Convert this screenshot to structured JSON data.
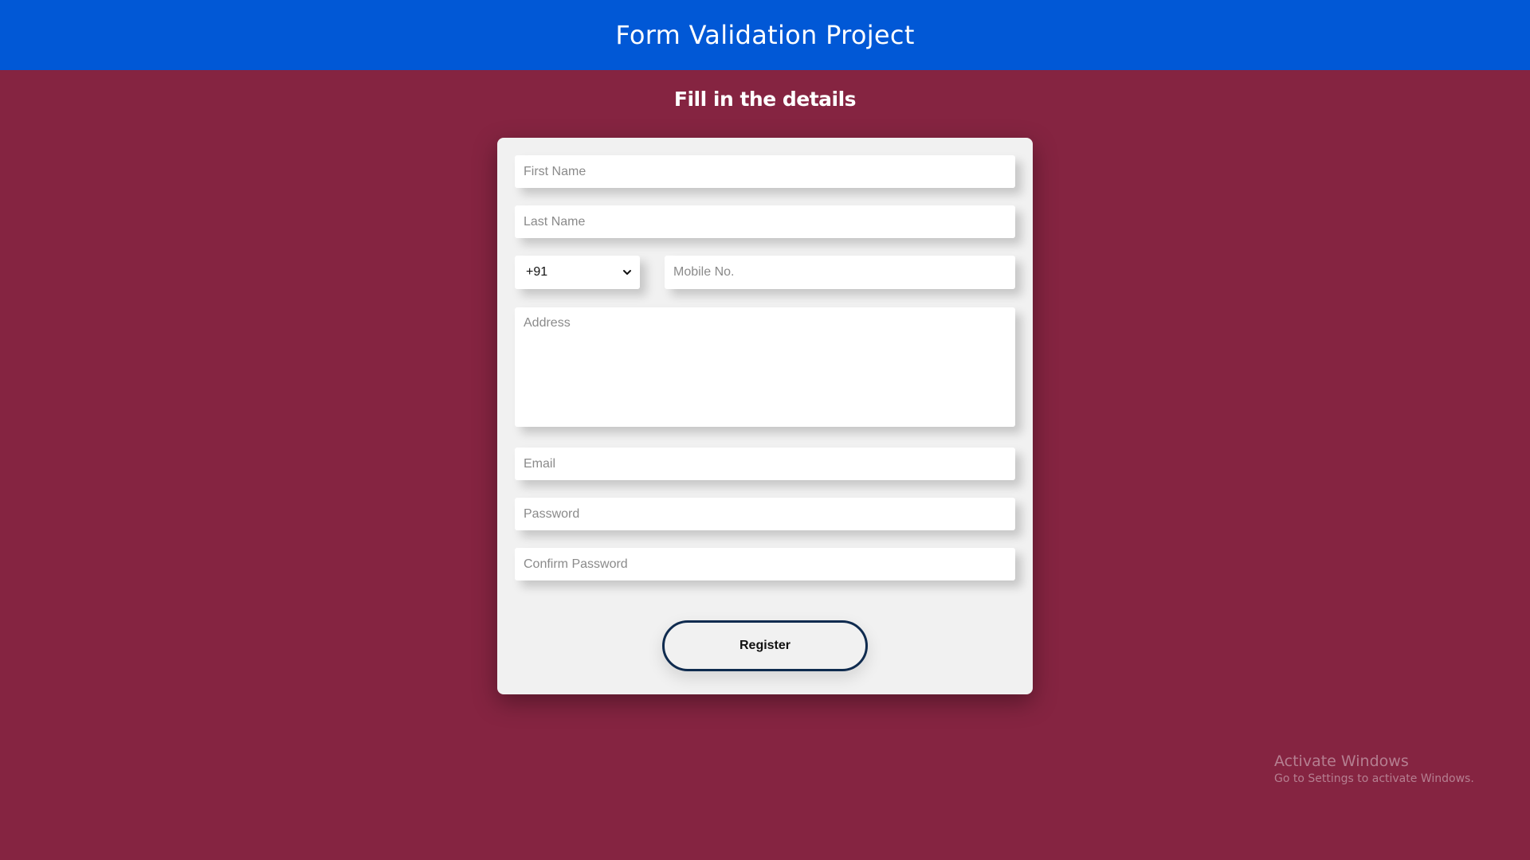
{
  "header": {
    "title": "Form Validation Project"
  },
  "form": {
    "heading": "Fill in the details",
    "first_name": {
      "placeholder": "First Name",
      "value": ""
    },
    "last_name": {
      "placeholder": "Last Name",
      "value": ""
    },
    "country_code": {
      "selected": "+91",
      "icon": "chevron-down-icon"
    },
    "mobile": {
      "placeholder": "Mobile No.",
      "value": ""
    },
    "address": {
      "placeholder": "Address",
      "value": ""
    },
    "email": {
      "placeholder": "Email",
      "value": ""
    },
    "password": {
      "placeholder": "Password",
      "value": ""
    },
    "confirm_password": {
      "placeholder": "Confirm Password",
      "value": ""
    },
    "register_label": "Register"
  },
  "watermark": {
    "title": "Activate Windows",
    "subtitle": "Go to Settings to activate Windows."
  },
  "colors": {
    "header_bg": "#0158d6",
    "page_bg": "#852441",
    "card_bg": "#f1f1f1",
    "button_border": "#0f2b4f"
  }
}
